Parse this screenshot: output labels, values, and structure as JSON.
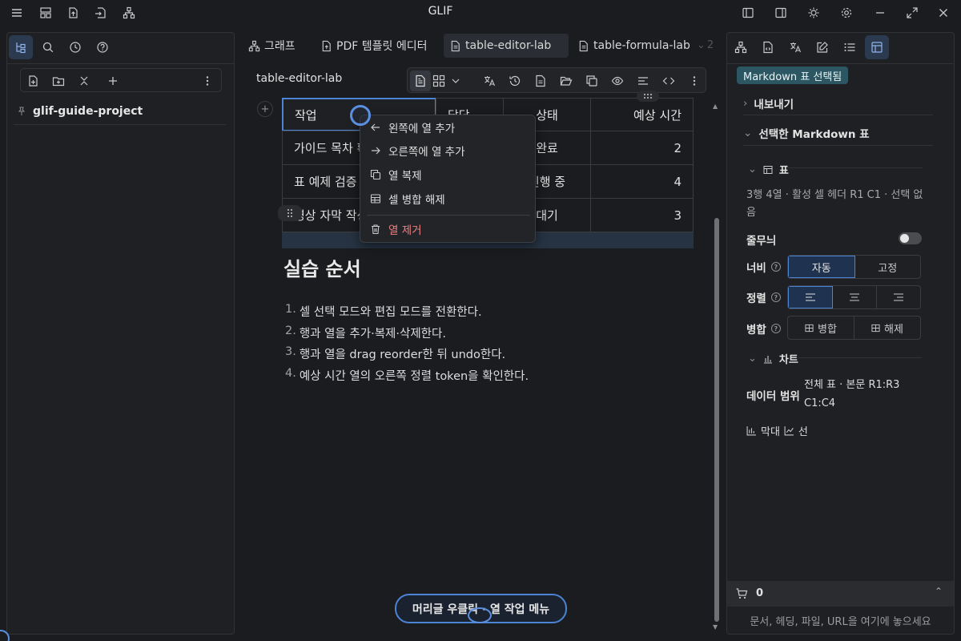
{
  "app": {
    "title": "GLIF"
  },
  "left_panel": {
    "tabs": [
      "file-tree-icon",
      "search-icon",
      "history-icon",
      "help-icon"
    ],
    "toolbar": [
      "new-file-icon",
      "new-folder-icon",
      "collapse-icon",
      "plus-icon",
      "more-icon"
    ],
    "project": "glif-guide-project"
  },
  "tabs": [
    {
      "label": "그래프",
      "icon": "graph-icon",
      "active": false
    },
    {
      "label": "PDF 템플릿 에디터",
      "icon": "pdf-icon",
      "active": false
    },
    {
      "label": "table-editor-lab",
      "icon": "doc-icon",
      "active": true
    },
    {
      "label": "table-formula-lab",
      "icon": "doc-icon",
      "active": false
    }
  ],
  "tab_overflow": "2",
  "doc": {
    "title": "table-editor-lab"
  },
  "table": {
    "headers": [
      "작업",
      "담당",
      "상태",
      "예상 시간"
    ],
    "rows": [
      [
        "가이드 목차 확",
        "",
        "완료",
        "2"
      ],
      [
        "표 예제 검증",
        "",
        "진행 중",
        "4"
      ],
      [
        "영상 자막 작성",
        "",
        "대기",
        "3"
      ]
    ]
  },
  "context_menu": {
    "items": [
      {
        "label": "왼쪽에 열 추가",
        "icon": "arrow-left-icon"
      },
      {
        "label": "오른쪽에 열 추가",
        "icon": "arrow-right-icon"
      },
      {
        "label": "열 복제",
        "icon": "copy-icon"
      },
      {
        "label": "셀 병합 해제",
        "icon": "table-icon"
      },
      {
        "label": "열 제거",
        "icon": "trash-icon",
        "danger": true
      }
    ]
  },
  "section": {
    "heading": "실습 순서",
    "steps": [
      {
        "n": "1.",
        "text": "셀 선택 모드와 편집 모드를 전환한다."
      },
      {
        "n": "2.",
        "text": "행과 열을 추가·복제·삭제한다."
      },
      {
        "n": "3.",
        "text": "행과 열을 drag reorder한 뒤 undo한다."
      },
      {
        "n": "4.",
        "text": "예상 시간 열의 오른쪽 정렬 token을 확인한다."
      }
    ]
  },
  "toast": "머리글 우클릭 · 열 작업 메뉴",
  "right_panel": {
    "badge": "Markdown 표 선택됨",
    "export": "내보내기",
    "selected": "선택한 Markdown 표",
    "table_section": "표",
    "table_info": "3행 4열 · 활성 셀 헤더 R1 C1 · 선택 없음",
    "wrap_label": "줄무늬",
    "width_label": "너비",
    "width_options": [
      "자동",
      "고정"
    ],
    "align_label": "정렬",
    "merge_label": "병합",
    "merge_options": [
      "병합",
      "해제"
    ],
    "chart_section": "차트",
    "data_range_label": "데이터 범위",
    "data_range_value": "전체 표 · 본문 R1:R3 C1:C4",
    "chart_types": [
      "막대",
      "선"
    ],
    "cart_count": "0",
    "dropzone": "문서, 헤딩, 파일, URL을 여기에 놓으세요"
  }
}
